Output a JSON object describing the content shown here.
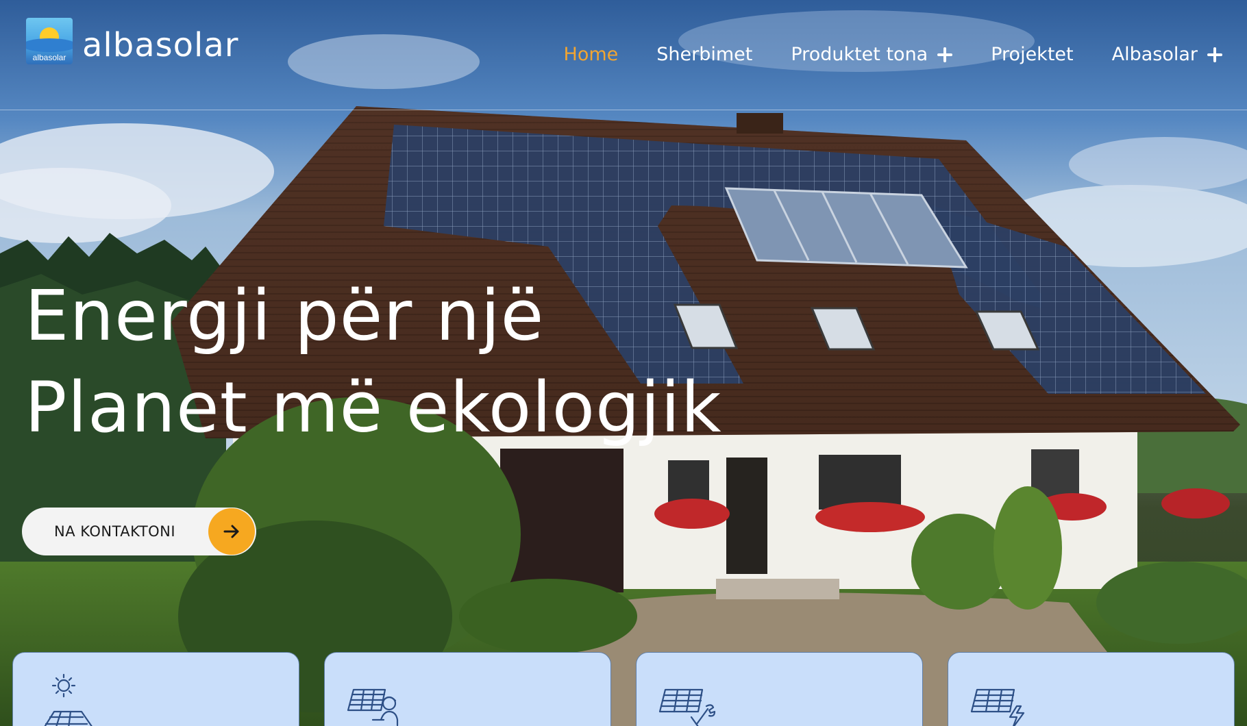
{
  "brand": {
    "logo_text": "albasolar",
    "name": "albasolar"
  },
  "nav": {
    "items": [
      {
        "label": "Home",
        "active": true,
        "has_submenu": false
      },
      {
        "label": "Sherbimet",
        "active": false,
        "has_submenu": false
      },
      {
        "label": "Produktet tona",
        "active": false,
        "has_submenu": true
      },
      {
        "label": "Projektet",
        "active": false,
        "has_submenu": false
      },
      {
        "label": "Albasolar",
        "active": false,
        "has_submenu": true
      }
    ]
  },
  "hero": {
    "headline_line1": "Energji për një",
    "headline_line2": "Planet më ekologjik",
    "cta_label": "NA KONTAKTONI"
  },
  "cards": [
    {
      "icon": "solar-house-icon"
    },
    {
      "icon": "solar-panel-worker-icon"
    },
    {
      "icon": "solar-panel-maintenance-icon"
    },
    {
      "icon": "solar-panel-energy-icon"
    }
  ],
  "colors": {
    "accent": "#f2a531",
    "cta_button_bg": "#f3f3f3",
    "cta_arrow_bg": "#f6a820",
    "card_bg": "#c9defa",
    "icon_stroke": "#2d4f86"
  }
}
